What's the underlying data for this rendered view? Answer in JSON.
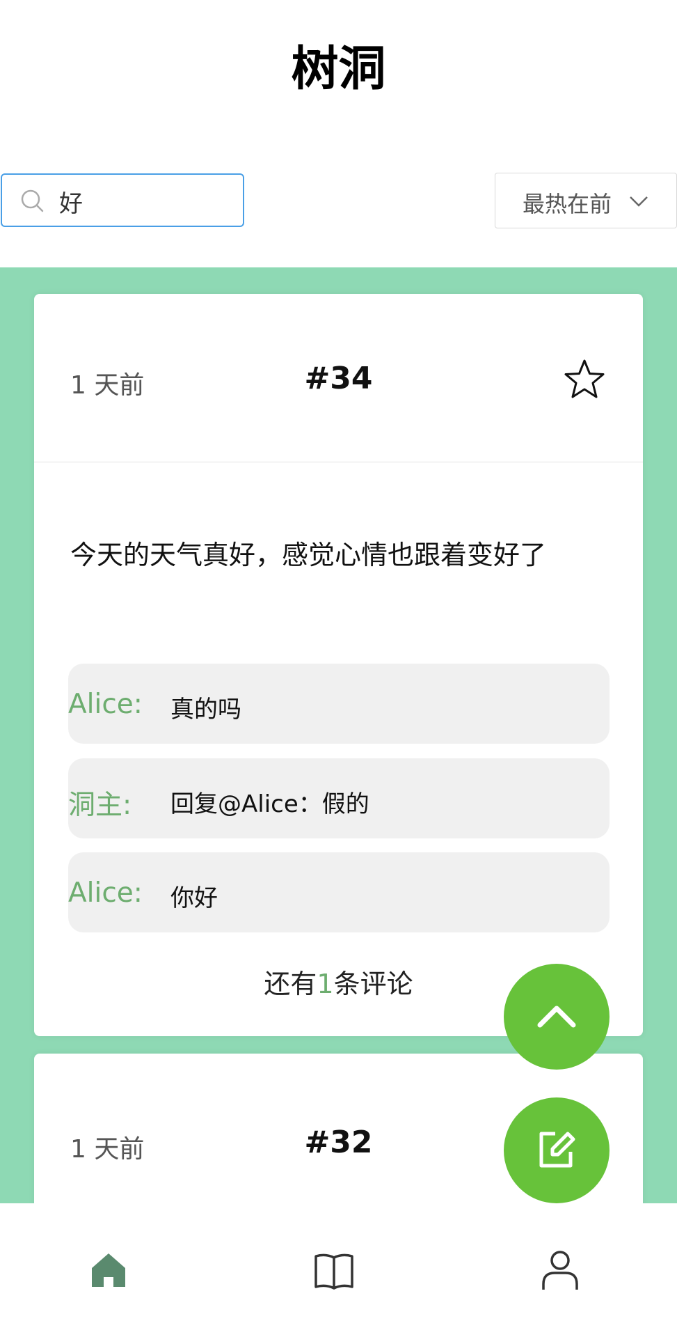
{
  "app": {
    "title": "树洞"
  },
  "search": {
    "value": "好",
    "icon": "search-icon"
  },
  "sort": {
    "selected": "最热在前",
    "icon": "chevron-down-icon"
  },
  "colors": {
    "accent_green": "#67c23a",
    "feed_background": "#8ed9b4",
    "author_green": "#6dad6f",
    "search_border": "#4a9fe6",
    "active_tab": "#5a8a6e"
  },
  "posts": [
    {
      "time": "1 天前",
      "number": "#34",
      "content": "今天的天气真好，感觉心情也跟着变好了",
      "comments": [
        {
          "author": "Alice:",
          "text": "真的吗"
        },
        {
          "author": "洞主:",
          "text": "回复@Alice：假的"
        },
        {
          "author": "Alice:",
          "text": "你好"
        }
      ],
      "more_prefix": "还有",
      "more_count": "1",
      "more_suffix": "条评论"
    },
    {
      "time": "1 天前",
      "number": "#32"
    }
  ],
  "fabs": {
    "scroll_top_icon": "chevron-up-icon",
    "compose_icon": "edit-icon"
  },
  "tabbar": {
    "items": [
      {
        "icon": "home-icon",
        "active": true
      },
      {
        "icon": "book-icon",
        "active": false
      },
      {
        "icon": "user-icon",
        "active": false
      }
    ]
  }
}
